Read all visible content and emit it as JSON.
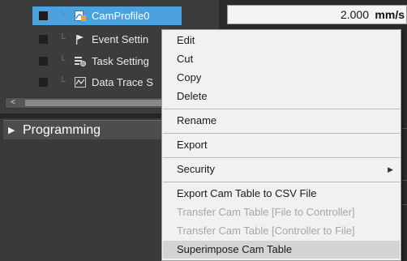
{
  "tree": {
    "items": [
      {
        "label": "CamProfile0",
        "icon": "cam-profile-icon",
        "selected": true
      },
      {
        "label": "Event Settin",
        "icon": "flag-icon"
      },
      {
        "label": "Task Setting",
        "icon": "task-icon"
      },
      {
        "label": "Data Trace S",
        "icon": "chart-icon"
      }
    ],
    "scroll_left_arrow": "<"
  },
  "programming": {
    "expand_glyph": "▶",
    "label": "Programming"
  },
  "right_pane": {
    "speed_value": "2.000",
    "speed_unit": "mm/s"
  },
  "context_menu": {
    "items": [
      {
        "label": "Edit",
        "enabled": true
      },
      {
        "label": "Cut",
        "enabled": true
      },
      {
        "label": "Copy",
        "enabled": true
      },
      {
        "label": "Delete",
        "enabled": true
      },
      {
        "label": "Rename",
        "enabled": true
      },
      {
        "label": "Export",
        "enabled": true
      },
      {
        "label": "Security",
        "enabled": true,
        "submenu_arrow": "▶"
      },
      {
        "label": "Export Cam Table to CSV File",
        "enabled": true
      },
      {
        "label": "Transfer Cam Table [File to Controller]",
        "enabled": false
      },
      {
        "label": "Transfer Cam Table [Controller to File]",
        "enabled": false
      },
      {
        "label": "Superimpose Cam Table",
        "enabled": true,
        "highlighted": true
      }
    ]
  },
  "colors": {
    "selection": "#4aa3df",
    "menu_bg": "#f1f1f1",
    "menu_highlight": "#d4d4d4",
    "disabled_text": "#a6a6a6"
  }
}
